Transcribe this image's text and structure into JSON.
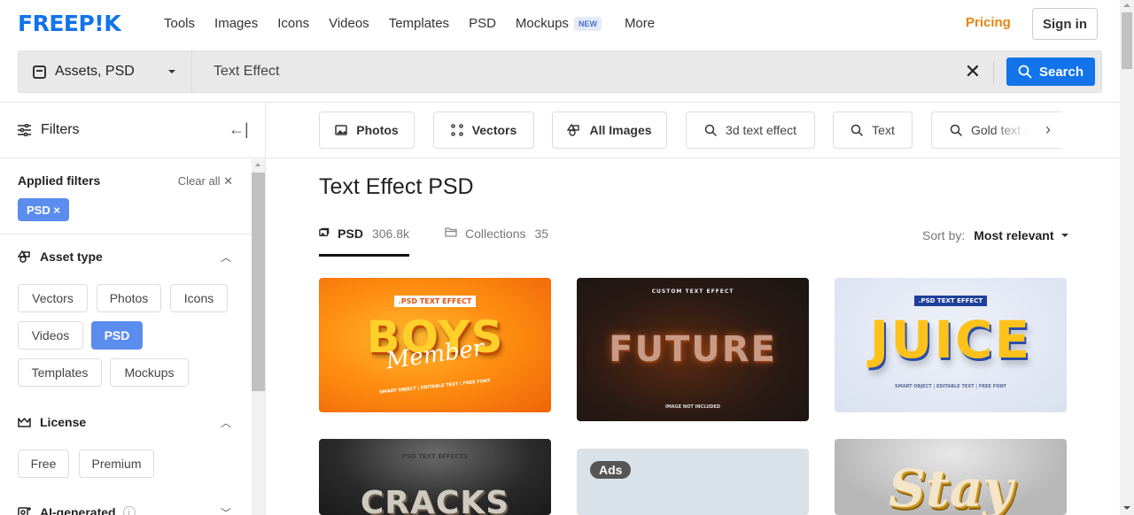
{
  "header": {
    "logo": "FREEP!K",
    "nav": [
      "Tools",
      "Images",
      "Icons",
      "Videos",
      "Templates",
      "PSD",
      "Mockups",
      "More"
    ],
    "nav_badge": "NEW",
    "pricing": "Pricing",
    "signin": "Sign in"
  },
  "search": {
    "asset_type": "Assets, PSD",
    "query": "Text Effect",
    "placeholder": "Search",
    "button": "Search"
  },
  "sidebar": {
    "title": "Filters",
    "applied_title": "Applied filters",
    "clear_all": "Clear all",
    "applied_chip": "PSD ×",
    "asset_type": {
      "title": "Asset type",
      "options": [
        "Vectors",
        "Photos",
        "Icons",
        "Videos",
        "PSD",
        "Templates",
        "Mockups"
      ],
      "selected": "PSD"
    },
    "license": {
      "title": "License",
      "options": [
        "Free",
        "Premium"
      ]
    },
    "ai_generated": {
      "title": "AI-generated"
    }
  },
  "chips": [
    {
      "label": "Photos",
      "icon": "photo-icon"
    },
    {
      "label": "Vectors",
      "icon": "vector-icon"
    },
    {
      "label": "All Images",
      "icon": "shapes-icon"
    },
    {
      "label": "3d text effect",
      "icon": "search-icon"
    },
    {
      "label": "Text",
      "icon": "search-icon"
    },
    {
      "label": "Gold text effect",
      "icon": "search-icon"
    }
  ],
  "main": {
    "title": "Text Effect PSD",
    "tabs": [
      {
        "label": "PSD",
        "count": "306.8k"
      },
      {
        "label": "Collections",
        "count": "35"
      }
    ],
    "sort_label": "Sort by:",
    "sort_value": "Most relevant"
  },
  "cards": [
    {
      "title": "BOYS",
      "subtitle": "Member",
      "tag": ".PSD TEXT EFFECT"
    },
    {
      "title": "FUTURE",
      "subtitle": "IMAGE NOT INCLUDED",
      "tag": "CUSTOM TEXT EFFECT"
    },
    {
      "title": "JUICE",
      "subtitle": "SMART OBJECT | EDITABLE TEXT | FREE FONT",
      "tag": ".PSD TEXT EFFECT"
    },
    {
      "title": "CRACKS",
      "tag": "PSD TEXT EFFECTS"
    },
    {
      "ads": "Ads"
    },
    {
      "title": "Stay"
    }
  ]
}
